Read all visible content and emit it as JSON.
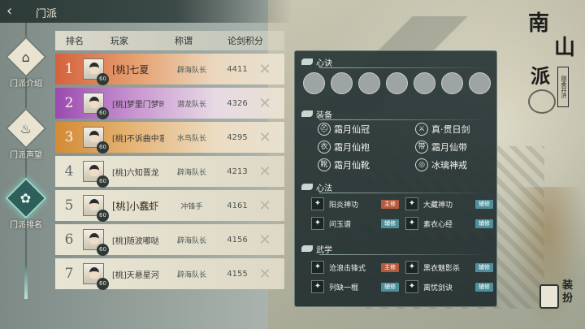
{
  "topbar": {
    "title": "门派"
  },
  "nav": [
    {
      "label": "门派介绍",
      "icon": "tower-icon"
    },
    {
      "label": "门派声望",
      "icon": "flame-icon"
    },
    {
      "label": "门派排名",
      "icon": "crest-icon"
    }
  ],
  "rank": {
    "headers": [
      "排名",
      "玩家",
      "称谓",
      "论剑积分"
    ],
    "rows": [
      {
        "rank": "1",
        "name": "[桃]七夏",
        "title": "辟海队长",
        "score": "4411",
        "level": "60"
      },
      {
        "rank": "2",
        "name": "[桃]梦里门梦时",
        "title": "潜龙队长",
        "score": "4326",
        "level": "60"
      },
      {
        "rank": "3",
        "name": "[桃]不诉曲中意",
        "title": "水鸟队长",
        "score": "4295",
        "level": "60"
      },
      {
        "rank": "4",
        "name": "[桃]六知晋龙",
        "title": "辟海队长",
        "score": "4213",
        "level": "60"
      },
      {
        "rank": "5",
        "name": "[桃]小蠢虾",
        "title": "冲锋手",
        "score": "4161",
        "level": "60"
      },
      {
        "rank": "6",
        "name": "[桃]随波嘟哒",
        "title": "辟海队长",
        "score": "4156",
        "level": "60"
      },
      {
        "rank": "7",
        "name": "[桃]天悬星河",
        "title": "辟海队长",
        "score": "4155",
        "level": "60"
      }
    ]
  },
  "detail": {
    "xinjue_title": "心诀",
    "xinjue_slots": 7,
    "equip_title": "装备",
    "equip": [
      {
        "name": "霜月仙冠",
        "icon": "helmet-icon"
      },
      {
        "name": "真·贯日剑",
        "icon": "sword-icon"
      },
      {
        "name": "霜月仙袍",
        "icon": "robe-icon"
      },
      {
        "name": "霜月仙带",
        "icon": "belt-icon"
      },
      {
        "name": "霜月仙靴",
        "icon": "boots-icon"
      },
      {
        "name": "冰璃神戒",
        "icon": "ring-icon"
      }
    ],
    "xinfa_title": "心法",
    "xinfa": [
      {
        "name": "阳炎神功",
        "tag": "主修",
        "tag_type": "main"
      },
      {
        "name": "大藏神功",
        "tag": "辅修",
        "tag_type": "aux"
      },
      {
        "name": "问玉谱",
        "tag": "辅修",
        "tag_type": "aux"
      },
      {
        "name": "素衣心经",
        "tag": "辅修",
        "tag_type": "aux"
      }
    ],
    "wuxue_title": "武学",
    "wuxue": [
      {
        "name": "沧浪击锋式",
        "tag": "主修",
        "tag_type": "main"
      },
      {
        "name": "黑衣魅影杀",
        "tag": "辅修",
        "tag_type": "aux"
      },
      {
        "name": "列缺一棍",
        "tag": "辅修",
        "tag_type": "aux"
      },
      {
        "name": "离忧剑诀",
        "tag": "辅修",
        "tag_type": "aux"
      }
    ]
  },
  "banner": {
    "line1": "南",
    "line2": "山",
    "line3": "派",
    "seal": "刚柔并济"
  },
  "dress": {
    "label": "装扮"
  }
}
